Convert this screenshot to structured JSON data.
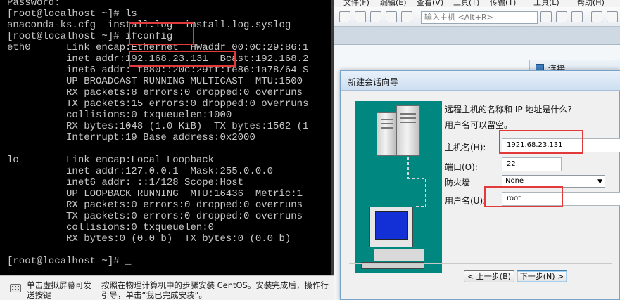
{
  "terminal": {
    "lines": [
      "Password:",
      "[root@localhost ~]# ls",
      "anaconda-ks.cfg  install.log  install.log.syslog",
      "[root@localhost ~]# ifconfig",
      "eth0      Link encap:Ethernet  HWaddr 00:0C:29:86:1",
      "          inet addr:192.168.23.131  Bcast:192.168.2",
      "          inet6 addr: fe80::20c:29ff:fe86:1a78/64 S",
      "          UP BROADCAST RUNNING MULTICAST  MTU:1500",
      "          RX packets:8 errors:0 dropped:0 overruns",
      "          TX packets:15 errors:0 dropped:0 overruns",
      "          collisions:0 txqueuelen:1000",
      "          RX bytes:1048 (1.0 KiB)  TX bytes:1562 (1",
      "          Interrupt:19 Base address:0x2000",
      "",
      "lo        Link encap:Local Loopback",
      "          inet addr:127.0.0.1  Mask:255.0.0.0",
      "          inet6 addr: ::1/128 Scope:Host",
      "          UP LOOPBACK RUNNING  MTU:16436  Metric:1",
      "          RX packets:0 errors:0 dropped:0 overruns",
      "          TX packets:0 errors:0 dropped:0 overruns",
      "          collisions:0 txqueuelen:0",
      "          RX bytes:0 (0.0 b)  TX bytes:0 (0.0 b)",
      "",
      "[root@localhost ~]# _"
    ]
  },
  "hintbar": {
    "left_text": "单击虚拟屏幕可发送按键",
    "right_text": "按照在物理计算机中的步骤安装 CentOS。安装完成后，操作行引导，单击“我已完成安装”。"
  },
  "app": {
    "menu": [
      "文件(F)",
      "编辑(E)",
      "查看(V)",
      "工具(T)",
      "传输(T)",
      "工具(L)",
      "帮助(H)"
    ],
    "host_input_placeholder": "输入主机 <Alt+R>",
    "side_panel_label": "连接"
  },
  "dialog": {
    "title": "新建会话向导",
    "question": "远程主机的名称和 IP 地址是什么?",
    "hint": "用户名可以留空。",
    "host_label": "主机名(H):",
    "host_value": "1921.68.23.131",
    "port_label": "端口(O):",
    "port_value": "22",
    "firewall_label": "防火墙",
    "firewall_value": "None",
    "username_label": "用户名(U):",
    "username_value": "root",
    "back_button": "< 上一步(B)",
    "next_button": "下一步(N) >"
  },
  "colors": {
    "highlight": "#e23a3a",
    "illustration_bg": "#00877f",
    "terminal_text": "#c8c8c8"
  }
}
